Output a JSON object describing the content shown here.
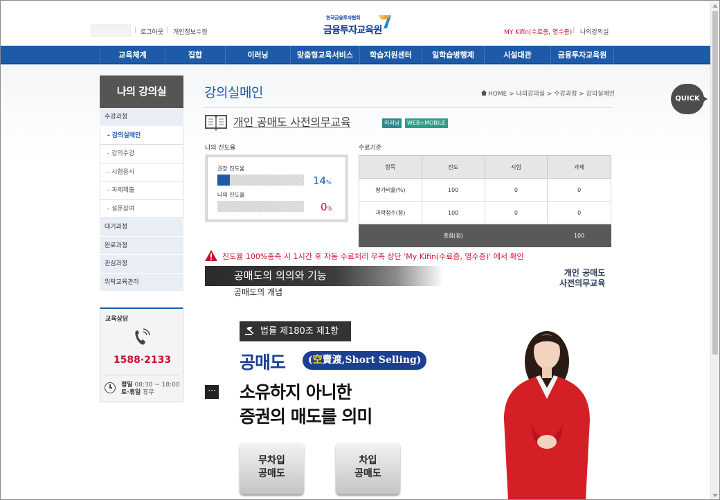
{
  "header": {
    "login_out": "로그아웃",
    "edit_info": "개인정보수정",
    "my_kifin": "MY Kifin(수료증, 영수증)",
    "my_classroom": "나의강의실",
    "logo_sub": "한국금융투자협회",
    "logo_main": "금융투자교육원"
  },
  "nav": [
    "교육체계",
    "집합",
    "이러닝",
    "맞춤형교육서비스",
    "학습지원센터",
    "일학습병행제",
    "시설대관",
    "금융투자교육원"
  ],
  "sidebar": {
    "title": "나의 강의실",
    "items": [
      {
        "label": "수강과정",
        "type": "main"
      },
      {
        "label": "- 강의실메인",
        "type": "sub",
        "active": true
      },
      {
        "label": "- 강의수강",
        "type": "sub"
      },
      {
        "label": "- 시험응시",
        "type": "sub"
      },
      {
        "label": "- 과제제출",
        "type": "sub"
      },
      {
        "label": "- 설문참여",
        "type": "sub"
      },
      {
        "label": "대기과정",
        "type": "main"
      },
      {
        "label": "완료과정",
        "type": "main"
      },
      {
        "label": "관심과정",
        "type": "main"
      },
      {
        "label": "위탁교육관리",
        "type": "main"
      }
    ],
    "consult": {
      "title": "교육상담",
      "phone": "1588·2133",
      "weekday_label": "평일",
      "weekday_hours": "08:30 ~ 18:00",
      "weekend_label": "토·휴일",
      "weekend_hours": "휴무"
    }
  },
  "main": {
    "page_title": "강의실메인",
    "breadcrumb": "HOME > 나의강의실 > 수강과정 > 강의실메인",
    "course_title": "개인 공매도 사전의무교육",
    "badges": [
      "이러닝",
      "WEB+MOBILE"
    ],
    "progress": {
      "label": "나의 진도율",
      "recommended_label": "권장 진도율",
      "recommended_value": "14",
      "recommended_fraction": 0.14,
      "mine_label": "나의 진도율",
      "mine_value": "0",
      "mine_fraction": 0,
      "unit": "%"
    },
    "criteria": {
      "label": "수료기준",
      "headers": [
        "항목",
        "진도",
        "시험",
        "과제"
      ],
      "rows": [
        [
          "평가비율(%)",
          "100",
          "0",
          "0"
        ],
        [
          "과락점수(점)",
          "100",
          "0",
          "0"
        ]
      ],
      "total_label": "총점(점)",
      "total_value": "100"
    },
    "warning": "진도율 100%충족 시 1시간 후 자동 수료처리 우측 상단 'My Kifin(수료증, 영수증)' 에서 확인"
  },
  "video": {
    "heading": "공매도의 의의와 기능",
    "subheading": "공매도의 개념",
    "corner_line1": "개인 공매도",
    "corner_line2": "사전의무교육",
    "law": "법률 제180조 제1항",
    "short_word": "공매도",
    "paren_open": "(",
    "paren_han_1": "空",
    "paren_han_rest": "賣渡,Short Selling",
    "paren_close": ")",
    "bullet": "···",
    "main_line1": "소유하지 아니한",
    "main_line2": "증권의 매도를 의미",
    "btn1_line1": "무차입",
    "btn1_line2": "공매도",
    "btn2_line1": "차입",
    "btn2_line2": "공매도"
  },
  "quick": "QUICK",
  "colors": {
    "nav": "#1d5aa8",
    "accent_red": "#c8102e",
    "title_blue": "#1d5aa8"
  }
}
